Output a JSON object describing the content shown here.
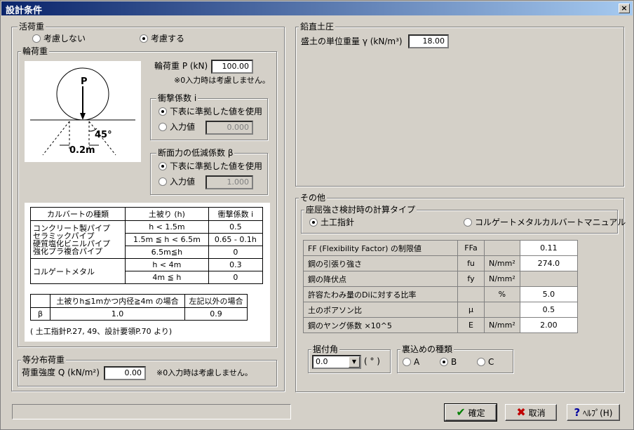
{
  "window": {
    "title": "設計条件",
    "close": "×"
  },
  "live_load": {
    "title": "活荷重",
    "opt_no": "考慮しない",
    "opt_yes": "考慮する",
    "selected": "考慮する"
  },
  "wheel_load": {
    "title": "輪荷重",
    "load_label": "輪荷重 P  (kN)",
    "load_value": "100.00",
    "note": "※0入力時は考慮しません。",
    "diagram": {
      "p": "P",
      "angle": "45°",
      "width": "0.2m"
    },
    "impact": {
      "title": "衝撃係数 i",
      "opt_table": "下表に準拠した値を使用",
      "opt_input": "入力値",
      "input_value": "0.000",
      "selected": "下表に準拠した値を使用"
    },
    "reduction": {
      "title": "断面力の低減係数 β",
      "opt_table": "下表に準拠した値を使用",
      "opt_input": "入力値",
      "input_value": "1.000",
      "selected": "下表に準拠した値を使用"
    },
    "table1": {
      "headers": [
        "カルバートの種類",
        "土被り (h)",
        "衝撃係数 i"
      ],
      "group1_types": [
        "コンクリート製パイプ",
        "セラミックパイプ",
        "硬質塩化ビニルパイプ",
        "強化プラ複合パイプ"
      ],
      "group1_rows": [
        [
          "h < 1.5m",
          "0.5"
        ],
        [
          "1.5m ≦ h < 6.5m",
          "0.65 - 0.1h"
        ],
        [
          "6.5m≦h",
          "0"
        ]
      ],
      "group2_type": "コルゲートメタル",
      "group2_rows": [
        [
          "h < 4m",
          "0.3"
        ],
        [
          "4m ≦ h",
          "0"
        ]
      ]
    },
    "table2": {
      "headers": [
        "土被りh≦1mかつ内径≧4m の場合",
        "左記以外の場合"
      ],
      "row_label": "β",
      "values": [
        "1.0",
        "0.9"
      ]
    },
    "source": "( 土工指針P.27, 49、設計要領P.70 より)"
  },
  "uniform": {
    "title": "等分布荷重",
    "label": "荷重強度 Q  (kN/m²)",
    "value": "0.00",
    "note": "※0入力時は考慮しません。"
  },
  "vertical": {
    "title": "鉛直土圧",
    "label": "盛土の単位重量 γ  (kN/m³)",
    "value": "18.00"
  },
  "other": {
    "title": "その他",
    "calc_type": {
      "title": "座屈強さ検討時の計算タイプ",
      "opt1": "土工指針",
      "opt2": "コルゲートメタルカルバートマニュアル",
      "selected": "土工指針"
    },
    "props": [
      {
        "label": "FF (Flexibility Factor) の制限値",
        "sym": "FFa",
        "unit": "",
        "value": "0.11"
      },
      {
        "label": "鋼の引張り強さ",
        "sym": "fu",
        "unit": "N/mm²",
        "value": "274.0"
      },
      {
        "label": "鋼の降伏点",
        "sym": "fy",
        "unit": "N/mm²",
        "value": ""
      },
      {
        "label": "許容たわみ量のDiに対する比率",
        "sym": "",
        "unit": "%",
        "value": "5.0"
      },
      {
        "label": "土のポアソン比",
        "sym": "μ",
        "unit": "",
        "value": "0.5"
      },
      {
        "label": "鋼のヤング係数 ×10^5",
        "sym": "E",
        "unit": "N/mm²",
        "value": "2.00"
      }
    ],
    "angle": {
      "title": "据付角",
      "value": "0.0",
      "unit": "( ° )"
    },
    "backfill": {
      "title": "裏込めの種類",
      "opts": [
        "A",
        "B",
        "C"
      ],
      "selected": "B"
    }
  },
  "buttons": {
    "ok": "確定",
    "cancel": "取消",
    "help": "ﾍﾙﾌﾟ(H)"
  },
  "colors": {
    "ok": "#008000",
    "cancel": "#c00000",
    "help": "#0000a0"
  }
}
